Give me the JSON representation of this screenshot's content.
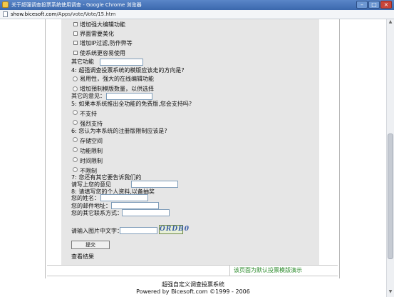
{
  "window": {
    "title": "关于超强调查投票系统使用调查 - Google Chrome 浏览器",
    "url_host": "show.bicesoft.com",
    "url_path": "/Apps/vote/Vote/15.htm"
  },
  "form": {
    "q3_options": [
      "增加强大编辑功能",
      "界面需要美化",
      "增加IP过滤,防作弊等",
      "使系统更容易使用"
    ],
    "q3_other_label": "其它功能",
    "q4": {
      "question": "4: 超强调查投票系统的模版应该走的方向是?",
      "options": [
        "易用性，强大的在线编辑功能",
        "增加預制模版数量，以供选择"
      ],
      "other_label": "其它的意见："
    },
    "q5": {
      "question": "5: 如果本系统推出全功能的免费版,您会支持吗?",
      "options": [
        "不支持",
        "强烈支持"
      ]
    },
    "q6": {
      "question": "6: 您认为本系统的注册版限制应该是?",
      "options": [
        "存储空间",
        "功能限制",
        "时间限制",
        "不限制"
      ]
    },
    "q7": {
      "question": "7: 您还有其它要告诉我们的",
      "field_label": "请写上您的意见"
    },
    "q8": {
      "question": "8: 请填写您的个人资料,以备抽奖",
      "name_label": "您的姓名：",
      "email_label": "您的邮件地址：",
      "contact_label": "您的其它联系方式："
    },
    "captcha_label": "请输入图片中文字：",
    "captcha_text": "ORDB0",
    "submit_label": "提交",
    "results_link": "查看结果"
  },
  "footer_strip": {
    "demo_text": "该页面为默认投票模版演示"
  },
  "copyright": {
    "line1": "超强自定义调查投票系统",
    "line2": "Powered by Bicesoft.com ©1999 - 2006"
  }
}
